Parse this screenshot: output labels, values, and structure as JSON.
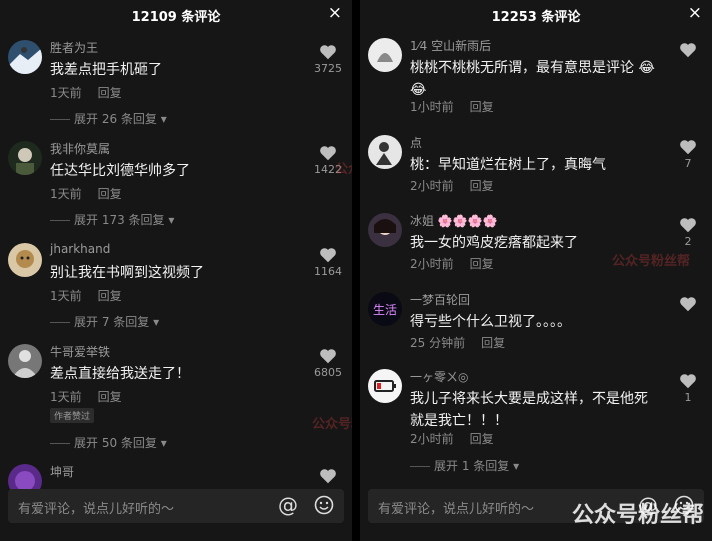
{
  "left": {
    "title": "12109 条评论",
    "comments": [
      {
        "user": "胜者为王",
        "text": "我差点把手机砸了",
        "time": "1天前",
        "reply": "回复",
        "likes": "3725",
        "expand": "展开 26 条回复"
      },
      {
        "user": "我非你莫属",
        "text": "任达华比刘德华帅多了",
        "time": "1天前",
        "reply": "回复",
        "likes": "1422",
        "expand": "展开 173 条回复"
      },
      {
        "user": "jharkhand",
        "text": "别让我在书啊到这视频了",
        "time": "1天前",
        "reply": "回复",
        "likes": "1164",
        "expand": "展开 7 条回复"
      },
      {
        "user": "牛哥爱举铁",
        "text": "差点直接给我送走了！",
        "time": "1天前",
        "reply": "回复",
        "likes": "6805",
        "badge": "作者赞过",
        "expand": "展开 50 条回复"
      },
      {
        "user": "坤哥"
      }
    ],
    "input_placeholder": "有爱评论，说点儿好听的～"
  },
  "right": {
    "title": "12253 条评论",
    "comments": [
      {
        "user": "1⁄4 空山新雨后",
        "text": "桃桃不桃桃无所谓，最有意思是评论",
        "time": "1小时前",
        "reply": "回复",
        "likes": ""
      },
      {
        "user": "点",
        "text": "桃：早知道烂在树上了，真晦气",
        "time": "2小时前",
        "reply": "回复",
        "likes": "7"
      },
      {
        "user": "冰姐",
        "text": "我一女的鸡皮疙瘩都起来了",
        "time": "2小时前",
        "reply": "回复",
        "likes": "2"
      },
      {
        "user": "一梦百轮回",
        "text": "得亏些个什么卫视了。。。。",
        "time": "25 分钟前",
        "reply": "回复",
        "likes": ""
      },
      {
        "user": "一ヶ零ㄨ◎",
        "text": "我儿子将来长大要是成这样，不是他死就是我亡！！！",
        "time": "2小时前",
        "reply": "回复",
        "likes": "1",
        "expand": "展开 1 条回复"
      }
    ],
    "input_placeholder": "有爱评论，说点儿好听的～"
  },
  "close_glyph": "×",
  "at_glyph": "@",
  "watermarks": [
    "公众号粉丝帮",
    "公众号粉丝帮",
    "公众号粉丝帮",
    "公众号粉丝帮"
  ],
  "colors": {
    "background": "#161616",
    "text": "#f2f2f2",
    "muted": "#8a8a8a",
    "input": "#252525"
  }
}
